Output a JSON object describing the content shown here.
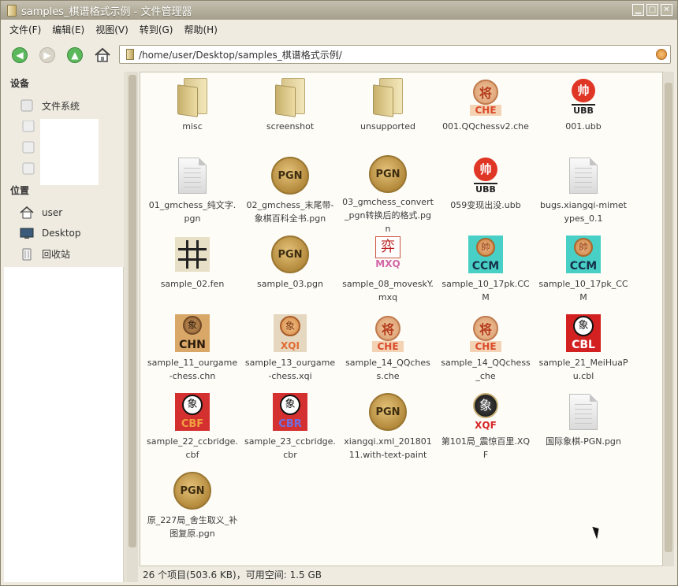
{
  "window": {
    "title": "samples_棋谱格式示例 - 文件管理器",
    "controls": {
      "minimize": "▁",
      "maximize": "□",
      "close": "✕"
    }
  },
  "menubar": [
    "文件(F)",
    "编辑(E)",
    "视图(V)",
    "转到(G)",
    "帮助(H)"
  ],
  "toolbar": {
    "back_icon": "back-arrow-icon",
    "forward_icon": "forward-arrow-icon",
    "up_icon": "up-arrow-icon",
    "home_icon": "home-icon",
    "location": "/home/user/Desktop/samples_棋谱格式示例/"
  },
  "sidebar": {
    "devices_heading": "设备",
    "devices": [
      {
        "label": "文件系统",
        "icon": "drive-icon"
      }
    ],
    "places_heading": "位置",
    "places": [
      {
        "label": "user",
        "icon": "home-icon"
      },
      {
        "label": "Desktop",
        "icon": "desktop-icon"
      },
      {
        "label": "回收站",
        "icon": "trash-icon"
      }
    ]
  },
  "files": [
    {
      "name": "misc",
      "type": "folder"
    },
    {
      "name": "screenshot",
      "type": "folder"
    },
    {
      "name": "unsupported",
      "type": "folder"
    },
    {
      "name": "001.QQchessv2.che",
      "type": "che",
      "glyph": "将",
      "label": "CHE"
    },
    {
      "name": "001.ubb",
      "type": "ubb",
      "glyph": "帅",
      "label": "UBB"
    },
    {
      "name": "01_gmchess_纯文字.pgn",
      "type": "doc"
    },
    {
      "name": "02_gmchess_末尾带-象棋百科全书.pgn",
      "type": "pgn",
      "label": "PGN"
    },
    {
      "name": "03_gmchess_convert_pgn转换后的格式.pgn",
      "type": "pgn",
      "label": "PGN"
    },
    {
      "name": "059变现出没.ubb",
      "type": "ubb",
      "glyph": "帅",
      "label": "UBB"
    },
    {
      "name": "bugs.xiangqi-mimetypes_0.1",
      "type": "doc"
    },
    {
      "name": "sample_02.fen",
      "type": "fen"
    },
    {
      "name": "sample_03.pgn",
      "type": "pgn",
      "label": "PGN"
    },
    {
      "name": "sample_08_moveskY.mxq",
      "type": "mxq",
      "glyph": "弈",
      "label": "MXQ"
    },
    {
      "name": "sample_10_17pk.CCM",
      "type": "ccm",
      "glyph": "帥",
      "label": "CCM"
    },
    {
      "name": "sample_10_17pk_CCM",
      "type": "ccm",
      "glyph": "帥",
      "label": "CCM"
    },
    {
      "name": "sample_11_ourgame-chess.chn",
      "type": "chn",
      "glyph": "象",
      "label": "CHN"
    },
    {
      "name": "sample_13_ourgame-chess.xqi",
      "type": "xqi",
      "glyph": "象",
      "label": "XQI"
    },
    {
      "name": "sample_14_QQchess.che",
      "type": "che",
      "glyph": "将",
      "label": "CHE"
    },
    {
      "name": "sample_14_QQchess_che",
      "type": "che",
      "glyph": "将",
      "label": "CHE"
    },
    {
      "name": "sample_21_MeiHuaPu.cbl",
      "type": "cbl",
      "glyph": "象",
      "label": "CBL"
    },
    {
      "name": "sample_22_ccbridge.cbf",
      "type": "cbf",
      "glyph": "象",
      "label": "CBF"
    },
    {
      "name": "sample_23_ccbridge.cbr",
      "type": "cbr",
      "glyph": "象",
      "label": "CBR"
    },
    {
      "name": "xiangqi.xml_20180111.with-text-paint",
      "type": "pgn",
      "label": "PGN"
    },
    {
      "name": "第101局_震惊百里.XQF",
      "type": "xqf",
      "glyph": "象",
      "label": "XQF"
    },
    {
      "name": "国际象棋-PGN.pgn",
      "type": "doc"
    },
    {
      "name": "原_227局_舍生取义_补图复原.pgn",
      "type": "pgn",
      "label": "PGN"
    }
  ],
  "status": "26 个项目(503.6 KB)，可用空间: 1.5 GB",
  "colors": {
    "titlebar": "#a49f8c",
    "background": "#efebe0",
    "content": "#fdfcf7",
    "accent_green": "#4caf50"
  }
}
